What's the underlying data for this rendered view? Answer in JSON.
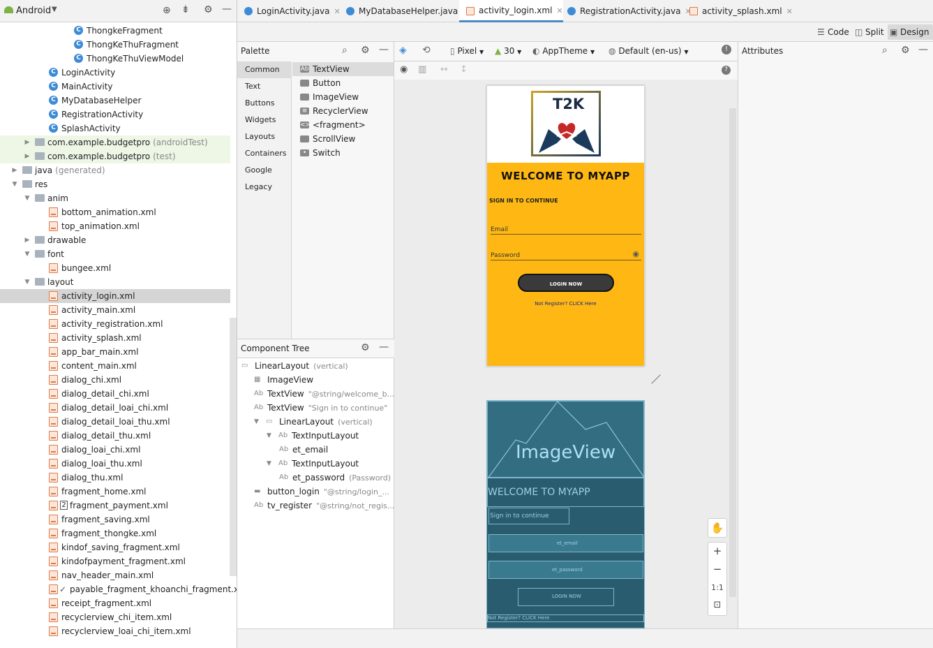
{
  "project": {
    "view_label": "Android",
    "tree": [
      {
        "label": "ThongkeFragment",
        "type": "class",
        "indent": 4
      },
      {
        "label": "ThongKeThuFragment",
        "type": "class",
        "indent": 4
      },
      {
        "label": "ThongKeThuViewModel",
        "type": "class",
        "indent": 4
      },
      {
        "label": "LoginActivity",
        "type": "class",
        "indent": 3
      },
      {
        "label": "MainActivity",
        "type": "class",
        "indent": 3
      },
      {
        "label": "MyDatabaseHelper",
        "type": "class",
        "indent": 3
      },
      {
        "label": "RegistrationActivity",
        "type": "class",
        "indent": 3
      },
      {
        "label": "SplashActivity",
        "type": "class",
        "indent": 3
      },
      {
        "label": "com.example.budgetpro",
        "suffix": "(androidTest)",
        "type": "package",
        "indent": 2,
        "arrow": "▶",
        "green": true
      },
      {
        "label": "com.example.budgetpro",
        "suffix": "(test)",
        "type": "package",
        "indent": 2,
        "arrow": "▶",
        "green": true
      },
      {
        "label": "java",
        "suffix": "(generated)",
        "type": "folder",
        "indent": 1,
        "arrow": "▶"
      },
      {
        "label": "res",
        "type": "folder",
        "indent": 1,
        "arrow": "▼"
      },
      {
        "label": "anim",
        "type": "folder",
        "indent": 2,
        "arrow": "▼"
      },
      {
        "label": "bottom_animation.xml",
        "type": "xml",
        "indent": 3
      },
      {
        "label": "top_animation.xml",
        "type": "xml",
        "indent": 3
      },
      {
        "label": "drawable",
        "type": "folder",
        "indent": 2,
        "arrow": "▶"
      },
      {
        "label": "font",
        "type": "folder",
        "indent": 2,
        "arrow": "▼"
      },
      {
        "label": "bungee.xml",
        "type": "xml",
        "indent": 3
      },
      {
        "label": "layout",
        "type": "folder",
        "indent": 2,
        "arrow": "▼"
      },
      {
        "label": "activity_login.xml",
        "type": "xml",
        "indent": 3,
        "selected": true
      },
      {
        "label": "activity_main.xml",
        "type": "xml",
        "indent": 3
      },
      {
        "label": "activity_registration.xml",
        "type": "xml",
        "indent": 3
      },
      {
        "label": "activity_splash.xml",
        "type": "xml",
        "indent": 3
      },
      {
        "label": "app_bar_main.xml",
        "type": "xml",
        "indent": 3
      },
      {
        "label": "content_main.xml",
        "type": "xml",
        "indent": 3
      },
      {
        "label": "dialog_chi.xml",
        "type": "xml",
        "indent": 3
      },
      {
        "label": "dialog_detail_chi.xml",
        "type": "xml",
        "indent": 3
      },
      {
        "label": "dialog_detail_loai_chi.xml",
        "type": "xml",
        "indent": 3
      },
      {
        "label": "dialog_detail_loai_thu.xml",
        "type": "xml",
        "indent": 3
      },
      {
        "label": "dialog_detail_thu.xml",
        "type": "xml",
        "indent": 3
      },
      {
        "label": "dialog_loai_chi.xml",
        "type": "xml",
        "indent": 3
      },
      {
        "label": "dialog_loai_thu.xml",
        "type": "xml",
        "indent": 3
      },
      {
        "label": "dialog_thu.xml",
        "type": "xml",
        "indent": 3
      },
      {
        "label": "fragment_home.xml",
        "type": "xml",
        "indent": 3
      },
      {
        "label": "fragment_payment.xml",
        "type": "xml",
        "indent": 3,
        "badge": "2"
      },
      {
        "label": "fragment_saving.xml",
        "type": "xml",
        "indent": 3
      },
      {
        "label": "fragment_thongke.xml",
        "type": "xml",
        "indent": 3
      },
      {
        "label": "kindof_saving_fragment.xml",
        "type": "xml",
        "indent": 3
      },
      {
        "label": "kindofpayment_fragment.xml",
        "type": "xml",
        "indent": 3
      },
      {
        "label": "nav_header_main.xml",
        "type": "xml",
        "indent": 3
      },
      {
        "label": "payable_fragment_khoanchi_fragment.xml",
        "type": "xml",
        "indent": 3,
        "check": "✓"
      },
      {
        "label": "receipt_fragment.xml",
        "type": "xml",
        "indent": 3
      },
      {
        "label": "recyclerview_chi_item.xml",
        "type": "xml",
        "indent": 3
      },
      {
        "label": "recyclerview_loai_chi_item.xml",
        "type": "xml",
        "indent": 3
      }
    ]
  },
  "tabs": [
    {
      "label": "LoginActivity.java",
      "kind": "class"
    },
    {
      "label": "MyDatabaseHelper.java",
      "kind": "class"
    },
    {
      "label": "activity_login.xml",
      "kind": "xml",
      "active": true
    },
    {
      "label": "RegistrationActivity.java",
      "kind": "class"
    },
    {
      "label": "activity_splash.xml",
      "kind": "xml"
    }
  ],
  "modes": {
    "code": "Code",
    "split": "Split",
    "design": "Design"
  },
  "palette": {
    "title": "Palette",
    "categories": [
      "Common",
      "Text",
      "Buttons",
      "Widgets",
      "Layouts",
      "Containers",
      "Google",
      "Legacy"
    ],
    "items": [
      "TextView",
      "Button",
      "ImageView",
      "RecyclerView",
      "<fragment>",
      "ScrollView",
      "Switch"
    ],
    "item_icons": [
      "Ab",
      "",
      "",
      "≡",
      "<>",
      "",
      "•"
    ]
  },
  "component_tree": {
    "title": "Component Tree",
    "rows": [
      {
        "label": "LinearLayout",
        "extra": "(vertical)",
        "icon": "▭",
        "indent": 0
      },
      {
        "label": "ImageView",
        "extra": "",
        "icon": "▦",
        "indent": 1
      },
      {
        "label": "TextView",
        "extra": "\"@string/welcome_b...",
        "icon": "Ab",
        "indent": 1
      },
      {
        "label": "TextView",
        "extra": "\"Sign in to continue\"",
        "icon": "Ab",
        "indent": 1
      },
      {
        "label": "LinearLayout",
        "extra": "(vertical)",
        "icon": "▭",
        "indent": 1,
        "arrow": "▼"
      },
      {
        "label": "TextInputLayout",
        "extra": "",
        "icon": "Ab",
        "indent": 2,
        "arrow": "▼"
      },
      {
        "label": "et_email",
        "extra": "",
        "icon": "Ab",
        "indent": 3
      },
      {
        "label": "TextInputLayout",
        "extra": "",
        "icon": "Ab",
        "indent": 2,
        "arrow": "▼"
      },
      {
        "label": "et_password",
        "extra": "(Password)",
        "icon": "Ab",
        "indent": 3
      },
      {
        "label": "button_login",
        "extra": "\"@string/login_...",
        "icon": "▬",
        "indent": 1
      },
      {
        "label": "tv_register",
        "extra": "\"@string/not_regis...",
        "icon": "Ab",
        "indent": 1
      }
    ]
  },
  "toolbar": {
    "device": "Pixel",
    "api": "30",
    "theme": "AppTheme",
    "locale": "Default (en-us)"
  },
  "attributes": {
    "title": "Attributes"
  },
  "preview": {
    "logo_text": "T2K",
    "welcome": "WELCOME TO MYAPP",
    "signin": "SIGN IN TO CONTINUE",
    "email_hint": "Email",
    "password_hint": "Password",
    "login_btn": "LOGIN NOW",
    "register": "Not Register? CLICK Here"
  },
  "blueprint": {
    "image": "ImageView",
    "welcome": "WELCOME TO MYAPP",
    "signin": "Sign in to continue",
    "email": "et_email",
    "password": "et_password",
    "login": "LOGIN NOW",
    "register": "Not Register? CLICK Here"
  },
  "zoom": {
    "plus": "+",
    "minus": "−",
    "ratio": "1:1"
  }
}
